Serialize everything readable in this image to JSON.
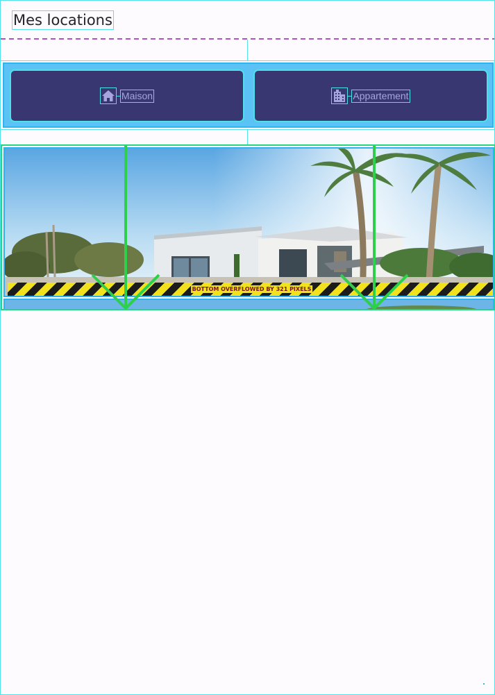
{
  "appbar": {
    "title": "Mes locations"
  },
  "filters": {
    "options": [
      {
        "label": "Maison",
        "icon": "home-icon"
      },
      {
        "label": "Appartement",
        "icon": "apartment-icon"
      }
    ]
  },
  "listing": {
    "overflow_warning": "BOTTOM OVERFLOWED BY 321 PIXELS"
  },
  "colors": {
    "background": "#fefbff",
    "button_fill": "#383771",
    "button_text": "#a7a4e0",
    "segment_bar": "#5ac2f5",
    "debug_outline": "#52e4ea",
    "debug_green": "#26d57e",
    "warning_yellow": "#f2e21d",
    "warning_text": "#7a1225"
  }
}
